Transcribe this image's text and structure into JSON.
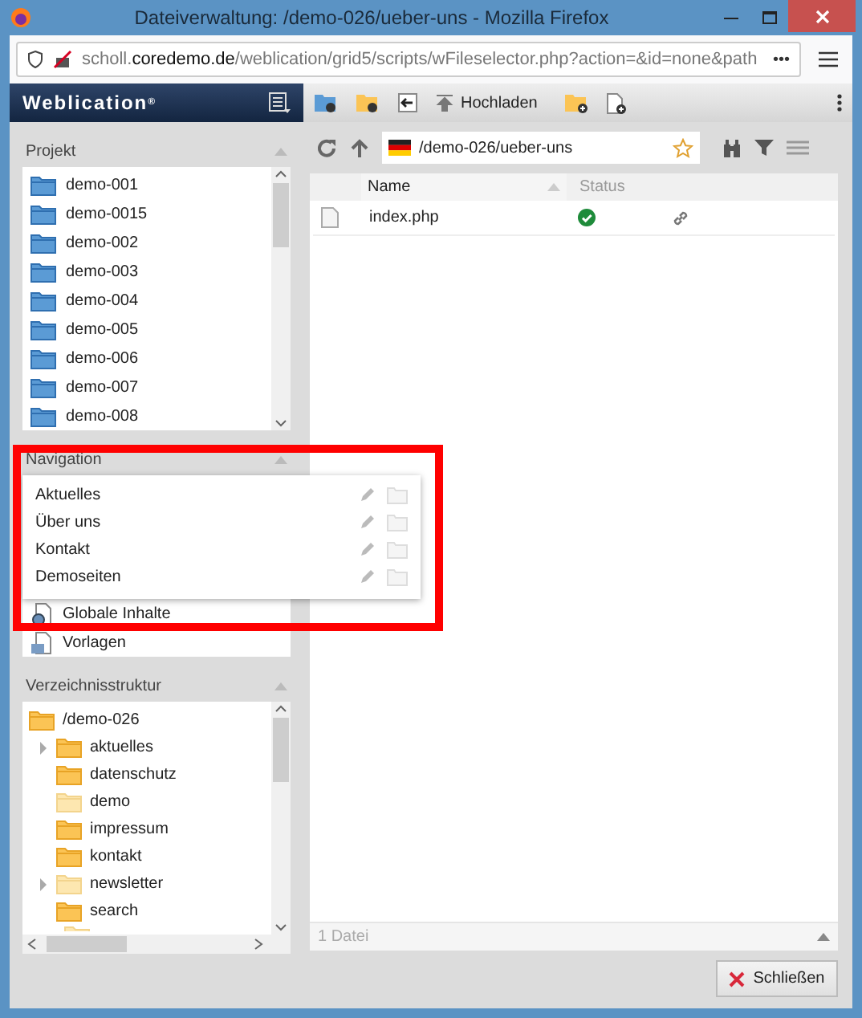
{
  "window": {
    "title": "Dateiverwaltung: /demo-026/ueber-uns - Mozilla Firefox"
  },
  "address_bar": {
    "url_prefix": "scholl.",
    "url_domain": "coredemo.de",
    "url_rest": "/weblication/grid5/scripts/wFileselector.php?action=&id=none&path",
    "more": "•••"
  },
  "app": {
    "logo": "Weblication",
    "logo_mark": "®"
  },
  "toolbar": {
    "upload_label": "Hochladen"
  },
  "projekt": {
    "title": "Projekt",
    "items": [
      "demo-001",
      "demo-0015",
      "demo-002",
      "demo-003",
      "demo-004",
      "demo-005",
      "demo-006",
      "demo-007",
      "demo-008"
    ]
  },
  "navigation": {
    "title": "Navigation",
    "items": [
      "Aktuelles",
      "Über uns",
      "Kontakt",
      "Demoseiten"
    ],
    "behind_items": [
      {
        "label": "Globale Inhalte",
        "kind": "globe"
      },
      {
        "label": "Vorlagen",
        "kind": "template"
      }
    ]
  },
  "tree": {
    "title": "Verzeichnisstruktur",
    "root": {
      "label": "/demo-026",
      "children": [
        {
          "label": "aktuelles",
          "has_children": true,
          "dimmed": false
        },
        {
          "label": "datenschutz",
          "has_children": false,
          "dimmed": false
        },
        {
          "label": "demo",
          "has_children": false,
          "dimmed": true
        },
        {
          "label": "impressum",
          "has_children": false,
          "dimmed": false
        },
        {
          "label": "kontakt",
          "has_children": false,
          "dimmed": false
        },
        {
          "label": "newsletter",
          "has_children": true,
          "dimmed": true
        },
        {
          "label": "search",
          "has_children": false,
          "dimmed": false
        }
      ]
    }
  },
  "path_field": {
    "value": "/demo-026/ueber-uns"
  },
  "table": {
    "columns": [
      "Name",
      "Status"
    ],
    "rows": [
      {
        "name": "index.php",
        "status_ok": true,
        "linked": true
      }
    ],
    "footer": "1 Datei"
  },
  "buttons": {
    "close": "Schließen"
  }
}
